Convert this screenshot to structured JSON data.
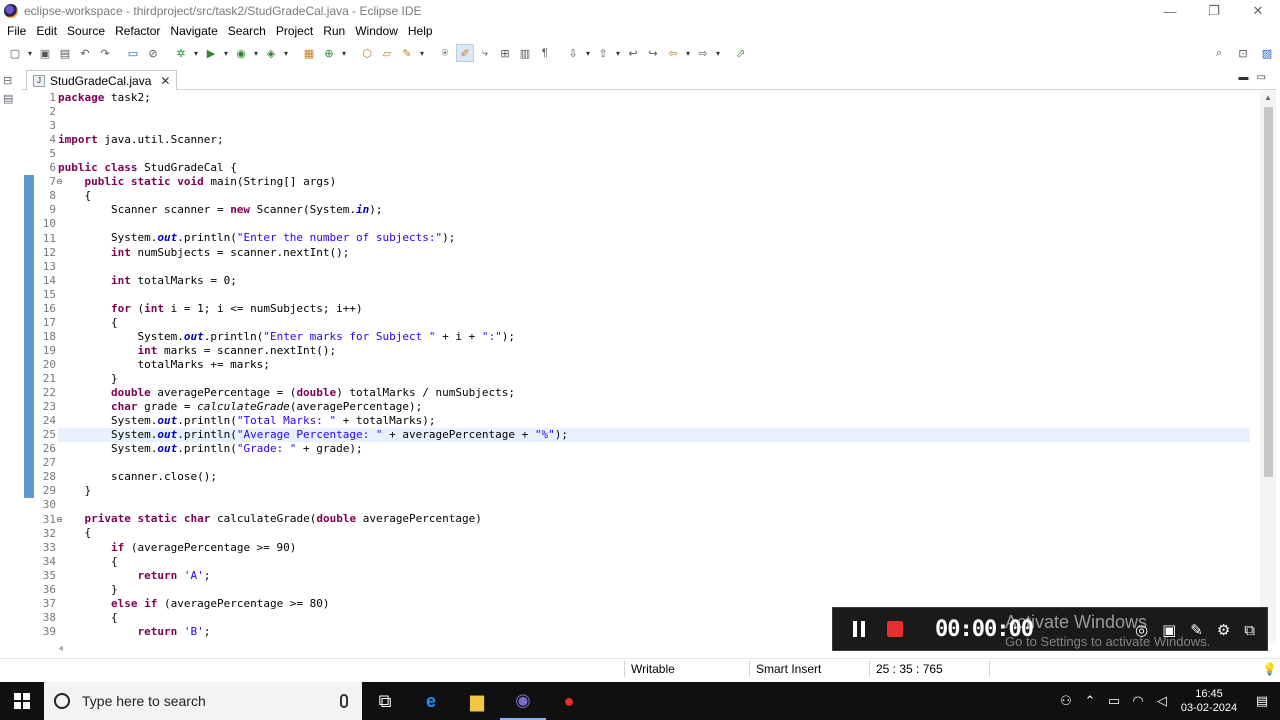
{
  "window": {
    "title": "eclipse-workspace - thirdproject/src/task2/StudGradeCal.java - Eclipse IDE",
    "minimize": "—",
    "maximize": "❐",
    "close": "✕"
  },
  "menu": [
    "File",
    "Edit",
    "Source",
    "Refactor",
    "Navigate",
    "Search",
    "Project",
    "Run",
    "Window",
    "Help"
  ],
  "editor": {
    "tab_label": "StudGradeCal.java",
    "tab_close": "✕",
    "current_line": 25,
    "lines": [
      {
        "n": "1",
        "segs": [
          {
            "t": "package",
            "c": "kw"
          },
          {
            "t": " task2;"
          }
        ]
      },
      {
        "n": "2",
        "segs": []
      },
      {
        "n": "3",
        "segs": []
      },
      {
        "n": "4",
        "segs": [
          {
            "t": "import",
            "c": "kw"
          },
          {
            "t": " java.util.Scanner;"
          }
        ]
      },
      {
        "n": "5",
        "segs": []
      },
      {
        "n": "6",
        "segs": [
          {
            "t": "public",
            "c": "kw"
          },
          {
            "t": " "
          },
          {
            "t": "class",
            "c": "kw"
          },
          {
            "t": " StudGradeCal {"
          }
        ]
      },
      {
        "n": "7",
        "fold": true,
        "segs": [
          {
            "t": "    "
          },
          {
            "t": "public",
            "c": "kw"
          },
          {
            "t": " "
          },
          {
            "t": "static",
            "c": "kw"
          },
          {
            "t": " "
          },
          {
            "t": "void",
            "c": "kw"
          },
          {
            "t": " main(String[] args)"
          }
        ]
      },
      {
        "n": "8",
        "segs": [
          {
            "t": "    {"
          }
        ]
      },
      {
        "n": "9",
        "segs": [
          {
            "t": "        Scanner scanner = "
          },
          {
            "t": "new",
            "c": "kw"
          },
          {
            "t": " Scanner(System."
          },
          {
            "t": "in",
            "c": "fld"
          },
          {
            "t": ");"
          }
        ]
      },
      {
        "n": "10",
        "segs": []
      },
      {
        "n": "11",
        "segs": [
          {
            "t": "        System."
          },
          {
            "t": "out",
            "c": "fld"
          },
          {
            "t": ".println("
          },
          {
            "t": "\"Enter the number of subjects:\"",
            "c": "str"
          },
          {
            "t": ");"
          }
        ]
      },
      {
        "n": "12",
        "segs": [
          {
            "t": "        "
          },
          {
            "t": "int",
            "c": "kw"
          },
          {
            "t": " numSubjects = scanner.nextInt();"
          }
        ]
      },
      {
        "n": "13",
        "segs": []
      },
      {
        "n": "14",
        "segs": [
          {
            "t": "        "
          },
          {
            "t": "int",
            "c": "kw"
          },
          {
            "t": " totalMarks = 0;"
          }
        ]
      },
      {
        "n": "15",
        "segs": []
      },
      {
        "n": "16",
        "segs": [
          {
            "t": "        "
          },
          {
            "t": "for",
            "c": "kw"
          },
          {
            "t": " ("
          },
          {
            "t": "int",
            "c": "kw"
          },
          {
            "t": " i = 1; i <= numSubjects; i++)"
          }
        ]
      },
      {
        "n": "17",
        "segs": [
          {
            "t": "        {"
          }
        ]
      },
      {
        "n": "18",
        "segs": [
          {
            "t": "            System."
          },
          {
            "t": "out",
            "c": "fld"
          },
          {
            "t": ".println("
          },
          {
            "t": "\"Enter marks for Subject \"",
            "c": "str"
          },
          {
            "t": " + i + "
          },
          {
            "t": "\":\"",
            "c": "str"
          },
          {
            "t": ");"
          }
        ]
      },
      {
        "n": "19",
        "segs": [
          {
            "t": "            "
          },
          {
            "t": "int",
            "c": "kw"
          },
          {
            "t": " marks = scanner.nextInt();"
          }
        ]
      },
      {
        "n": "20",
        "segs": [
          {
            "t": "            totalMarks += marks;"
          }
        ]
      },
      {
        "n": "21",
        "segs": [
          {
            "t": "        }"
          }
        ]
      },
      {
        "n": "22",
        "segs": [
          {
            "t": "        "
          },
          {
            "t": "double",
            "c": "kw"
          },
          {
            "t": " averagePercentage = ("
          },
          {
            "t": "double",
            "c": "kw"
          },
          {
            "t": ") totalMarks / numSubjects;"
          }
        ]
      },
      {
        "n": "23",
        "segs": [
          {
            "t": "        "
          },
          {
            "t": "char",
            "c": "kw"
          },
          {
            "t": " grade = "
          },
          {
            "t": "calculateGrade",
            "c": "sm"
          },
          {
            "t": "(averagePercentage);"
          }
        ]
      },
      {
        "n": "24",
        "segs": [
          {
            "t": "        System."
          },
          {
            "t": "out",
            "c": "fld"
          },
          {
            "t": ".println("
          },
          {
            "t": "\"Total Marks: \"",
            "c": "str"
          },
          {
            "t": " + totalMarks);"
          }
        ]
      },
      {
        "n": "25",
        "segs": [
          {
            "t": "        System."
          },
          {
            "t": "out",
            "c": "fld"
          },
          {
            "t": ".println("
          },
          {
            "t": "\"Average Percentage: \"",
            "c": "str"
          },
          {
            "t": " + averagePercentage + "
          },
          {
            "t": "\"%\"",
            "c": "str"
          },
          {
            "t": ");"
          }
        ]
      },
      {
        "n": "26",
        "segs": [
          {
            "t": "        System."
          },
          {
            "t": "out",
            "c": "fld"
          },
          {
            "t": ".println("
          },
          {
            "t": "\"Grade: \"",
            "c": "str"
          },
          {
            "t": " + grade);"
          }
        ]
      },
      {
        "n": "27",
        "segs": []
      },
      {
        "n": "28",
        "segs": [
          {
            "t": "        scanner.close();"
          }
        ]
      },
      {
        "n": "29",
        "segs": [
          {
            "t": "    }"
          }
        ]
      },
      {
        "n": "30",
        "segs": []
      },
      {
        "n": "31",
        "fold": true,
        "segs": [
          {
            "t": "    "
          },
          {
            "t": "private",
            "c": "kw"
          },
          {
            "t": " "
          },
          {
            "t": "static",
            "c": "kw"
          },
          {
            "t": " "
          },
          {
            "t": "char",
            "c": "kw"
          },
          {
            "t": " calculateGrade("
          },
          {
            "t": "double",
            "c": "kw"
          },
          {
            "t": " averagePercentage)"
          }
        ]
      },
      {
        "n": "32",
        "segs": [
          {
            "t": "    {"
          }
        ]
      },
      {
        "n": "33",
        "segs": [
          {
            "t": "        "
          },
          {
            "t": "if",
            "c": "kw"
          },
          {
            "t": " (averagePercentage >= 90)"
          }
        ]
      },
      {
        "n": "34",
        "segs": [
          {
            "t": "        {"
          }
        ]
      },
      {
        "n": "35",
        "segs": [
          {
            "t": "            "
          },
          {
            "t": "return",
            "c": "kw"
          },
          {
            "t": " "
          },
          {
            "t": "'A'",
            "c": "str"
          },
          {
            "t": ";"
          }
        ]
      },
      {
        "n": "36",
        "segs": [
          {
            "t": "        }"
          }
        ]
      },
      {
        "n": "37",
        "segs": [
          {
            "t": "        "
          },
          {
            "t": "else",
            "c": "kw"
          },
          {
            "t": " "
          },
          {
            "t": "if",
            "c": "kw"
          },
          {
            "t": " (averagePercentage >= 80)"
          }
        ]
      },
      {
        "n": "38",
        "segs": [
          {
            "t": "        {"
          }
        ]
      },
      {
        "n": "39",
        "segs": [
          {
            "t": "            "
          },
          {
            "t": "return",
            "c": "kw"
          },
          {
            "t": " "
          },
          {
            "t": "'B'",
            "c": "str"
          },
          {
            "t": ";"
          }
        ]
      }
    ]
  },
  "status": {
    "writable": "Writable",
    "insert_mode": "Smart Insert",
    "position": "25 : 35 : 765"
  },
  "recorder": {
    "timer": "00:00:00"
  },
  "watermark": {
    "line1": "Activate Windows",
    "line2": "Go to Settings to activate Windows."
  },
  "taskbar": {
    "search_placeholder": "Type here to search",
    "time": "16:45",
    "date": "03-02-2024"
  },
  "colors": {
    "keyword": "#7f0055",
    "string": "#2a00ff",
    "field": "#0000c0",
    "current_line_bg": "#e8f2fe",
    "ruler_mark": "#5e98d2",
    "stop_button": "#e62e2e"
  }
}
